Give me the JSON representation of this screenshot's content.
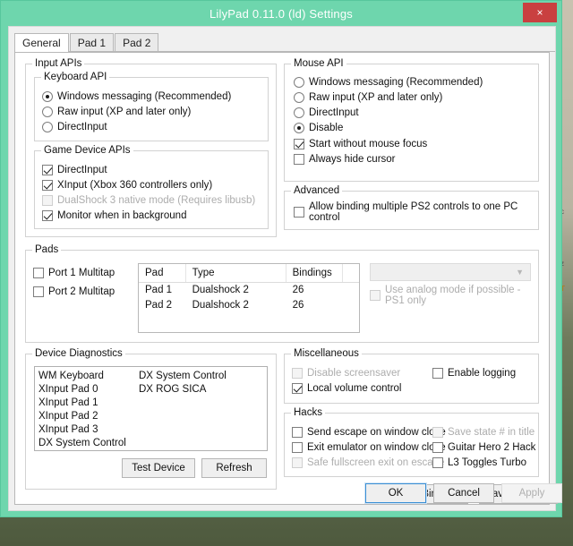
{
  "window": {
    "title": "LilyPad 0.11.0 (ld) Settings",
    "close_label": "×",
    "accent_color": "#6ed6ad",
    "close_color": "#c94040"
  },
  "tabs": [
    {
      "label": "General",
      "active": true
    },
    {
      "label": "Pad 1",
      "active": false
    },
    {
      "label": "Pad 2",
      "active": false
    }
  ],
  "input_apis": {
    "title": "Input APIs",
    "keyboard": {
      "title": "Keyboard API",
      "options": [
        {
          "label": "Windows messaging (Recommended)",
          "selected": true
        },
        {
          "label": "Raw input (XP and later only)",
          "selected": false
        },
        {
          "label": "DirectInput",
          "selected": false
        }
      ]
    },
    "game_device": {
      "title": "Game Device APIs",
      "options": [
        {
          "label": "DirectInput",
          "checked": true,
          "disabled": false
        },
        {
          "label": "XInput (Xbox 360 controllers only)",
          "checked": true,
          "disabled": false
        },
        {
          "label": "DualShock 3 native mode (Requires libusb)",
          "checked": false,
          "disabled": true
        },
        {
          "label": "Monitor when in background",
          "checked": true,
          "disabled": false
        }
      ]
    }
  },
  "mouse_api": {
    "title": "Mouse API",
    "radios": [
      {
        "label": "Windows messaging (Recommended)",
        "selected": false
      },
      {
        "label": "Raw input (XP and later only)",
        "selected": false
      },
      {
        "label": "DirectInput",
        "selected": false
      },
      {
        "label": "Disable",
        "selected": true
      }
    ],
    "checks": [
      {
        "label": "Start without mouse focus",
        "checked": true,
        "disabled": false
      },
      {
        "label": "Always hide cursor",
        "checked": false,
        "disabled": false
      }
    ]
  },
  "advanced": {
    "title": "Advanced",
    "checks": [
      {
        "label": "Allow binding multiple PS2 controls to one PC control",
        "checked": false,
        "disabled": false
      }
    ]
  },
  "pads": {
    "title": "Pads",
    "checks": [
      {
        "label": "Port 1 Multitap",
        "checked": false,
        "disabled": false
      },
      {
        "label": "Port 2 Multitap",
        "checked": false,
        "disabled": false
      }
    ],
    "table": {
      "columns": [
        "Pad",
        "Type",
        "Bindings",
        ""
      ],
      "rows": [
        [
          "Pad 1",
          "Dualshock 2",
          "26",
          ""
        ],
        [
          "Pad 2",
          "Dualshock 2",
          "26",
          ""
        ]
      ]
    },
    "combo": {
      "value": "",
      "disabled": true
    },
    "analog_check": {
      "label": "Use analog mode if possible - PS1 only",
      "checked": false,
      "disabled": true
    }
  },
  "diagnostics": {
    "title": "Device Diagnostics",
    "column_left": [
      "WM Keyboard",
      "XInput Pad 0",
      "XInput Pad 1",
      "XInput Pad 2",
      "XInput Pad 3",
      "DX System Control"
    ],
    "column_right": [
      "DX System Control",
      "DX ROG SICA"
    ],
    "test_device_label": "Test Device",
    "refresh_label": "Refresh"
  },
  "miscellaneous": {
    "title": "Miscellaneous",
    "left": [
      {
        "label": "Disable screensaver",
        "checked": false,
        "disabled": true
      },
      {
        "label": "Local volume control",
        "checked": true,
        "disabled": false
      }
    ],
    "right": [
      {
        "label": "Enable logging",
        "checked": false,
        "disabled": false
      }
    ]
  },
  "hacks": {
    "title": "Hacks",
    "left": [
      {
        "label": "Send escape on window close",
        "checked": false,
        "disabled": false
      },
      {
        "label": "Exit emulator on window close",
        "checked": false,
        "disabled": false
      },
      {
        "label": "Safe fullscreen exit on escape",
        "checked": false,
        "disabled": true
      }
    ],
    "right": [
      {
        "label": "Save state # in title",
        "checked": false,
        "disabled": true
      },
      {
        "label": "Guitar Hero 2 Hack",
        "checked": false,
        "disabled": false
      },
      {
        "label": "L3 Toggles Turbo",
        "checked": false,
        "disabled": false
      }
    ]
  },
  "bindings_buttons": {
    "load_label": "Load Bindings",
    "save_label": "Save Bindings"
  },
  "dialog_buttons": {
    "ok_label": "OK",
    "cancel_label": "Cancel",
    "apply_label": "Apply",
    "apply_disabled": true
  },
  "background": {
    "fragment1": "c",
    "fragment2": "z",
    "fragment3": "T"
  }
}
